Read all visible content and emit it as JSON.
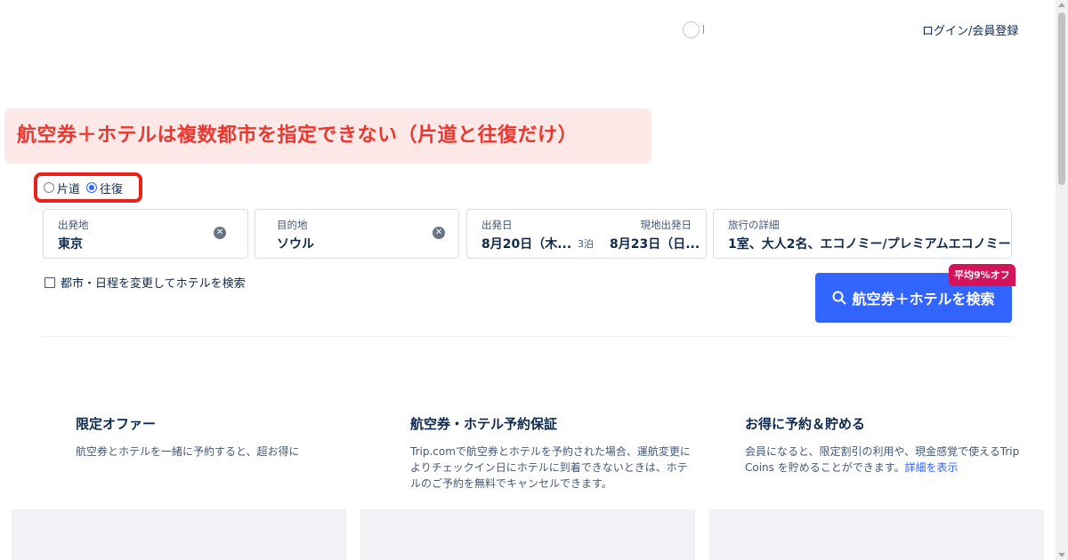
{
  "header": {
    "login_label": "ログイン/会員登録"
  },
  "annotation": {
    "text": "航空券＋ホテルは複数都市を指定できない（片道と往復だけ）"
  },
  "trip_type": {
    "options": [
      {
        "label": "片道",
        "checked": false
      },
      {
        "label": "往復",
        "checked": true
      }
    ]
  },
  "search": {
    "departure": {
      "label": "出発地",
      "value": "東京"
    },
    "destination": {
      "label": "目的地",
      "value": "ソウル"
    },
    "dates": {
      "depart_label": "出発日",
      "depart_value": "8月20日（木...",
      "nights": "3泊",
      "return_label": "現地出発日",
      "return_value": "8月23日（日..."
    },
    "details": {
      "label": "旅行の詳細",
      "value": "1室、大人2名、エコノミー/プレミアムエコノミー"
    },
    "change_city_label": "都市・日程を変更してホテルを検索",
    "button_label": "航空券＋ホテルを検索",
    "discount_badge": "平均9%オフ"
  },
  "features": [
    {
      "title": "限定オファー",
      "desc": "航空券とホテルを一緒に予約すると、超お得に"
    },
    {
      "title": "航空券・ホテル予約保証",
      "desc": "Trip.comで航空券とホテルを予約された場合、運航変更によりチェックイン日にホテルに到着できないときは、ホテルのご予約を無料でキャンセルできます。"
    },
    {
      "title": "お得に予約＆貯める",
      "desc": "会員になると、限定割引の利用や、現金感覚で使えるTrip Coins を貯めることができます。",
      "link": "詳細を表示"
    }
  ],
  "colors": {
    "primary": "#3264ff",
    "annotation_text": "#e8382f",
    "annotation_bg": "#fde8e8",
    "highlight_border": "#e8221a",
    "badge": "#d4145a",
    "text_dark": "#0f294d"
  }
}
